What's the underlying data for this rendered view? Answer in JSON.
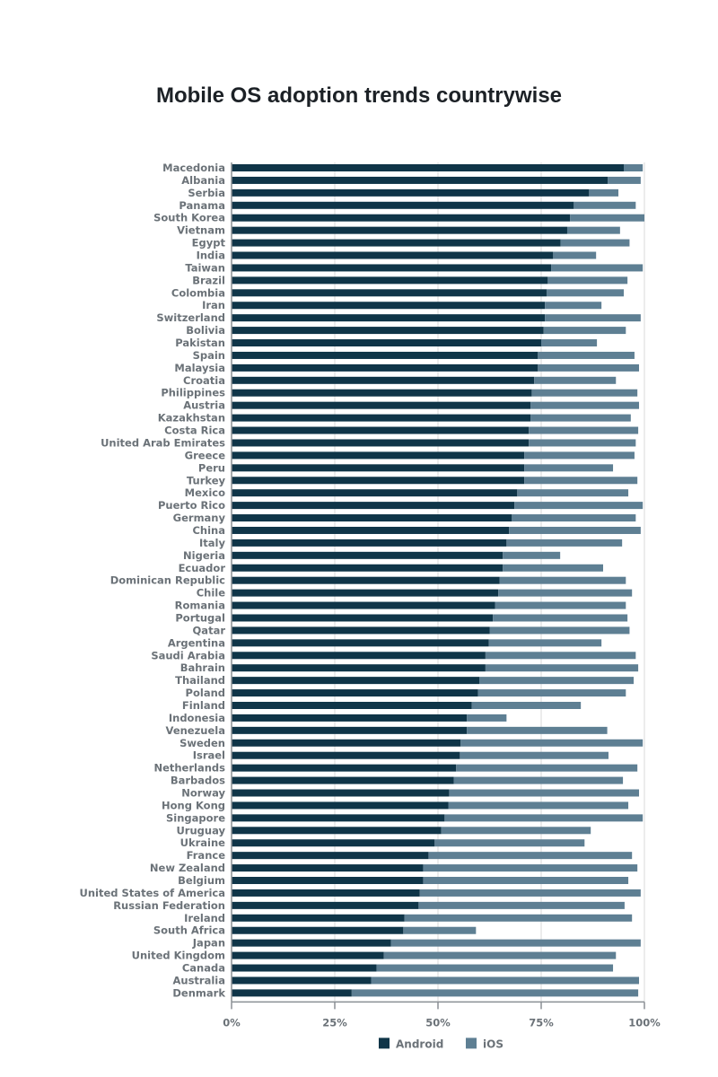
{
  "chart_data": {
    "type": "bar",
    "orientation": "horizontal",
    "stacked": true,
    "title": "Mobile OS adoption trends countrywise",
    "xlabel": "",
    "ylabel": "",
    "xlim": [
      0,
      100
    ],
    "x_ticks": [
      "0%",
      "25%",
      "50%",
      "75%",
      "100%"
    ],
    "x_tick_values": [
      0,
      25,
      50,
      75,
      100
    ],
    "grid": true,
    "legend_position": "bottom-center",
    "colors": {
      "Android": "#0f3548",
      "iOS": "#5e7f93"
    },
    "categories": [
      "Macedonia",
      "Albania",
      "Serbia",
      "Panama",
      "South Korea",
      "Vietnam",
      "Egypt",
      "India",
      "Taiwan",
      "Brazil",
      "Colombia",
      "Iran",
      "Switzerland",
      "Bolivia",
      "Pakistan",
      "Spain",
      "Malaysia",
      "Croatia",
      "Philippines",
      "Austria",
      "Kazakhstan",
      "Costa Rica",
      "United Arab Emirates",
      "Greece",
      "Peru",
      "Turkey",
      "Mexico",
      "Puerto Rico",
      "Germany",
      "China",
      "Italy",
      "Nigeria",
      "Ecuador",
      "Dominican Republic",
      "Chile",
      "Romania",
      "Portugal",
      "Qatar",
      "Argentina",
      "Saudi Arabia",
      "Bahrain",
      "Thailand",
      "Poland",
      "Finland",
      "Indonesia",
      "Venezuela",
      "Sweden",
      "Israel",
      "Netherlands",
      "Barbados",
      "Norway",
      "Hong Kong",
      "Singapore",
      "Uruguay",
      "Ukraine",
      "France",
      "New Zealand",
      "Belgium",
      "United States of America",
      "Russian Federation",
      "Ireland",
      "South Africa",
      "Japan",
      "United Kingdom",
      "Canada",
      "Australia",
      "Denmark"
    ],
    "series": [
      {
        "name": "Android",
        "values": [
          95.0,
          91.1,
          86.6,
          82.9,
          82.0,
          81.3,
          79.7,
          77.9,
          77.4,
          76.6,
          76.3,
          75.9,
          75.9,
          75.6,
          75.0,
          74.2,
          74.2,
          73.3,
          72.7,
          72.4,
          72.4,
          72.0,
          72.0,
          70.9,
          70.9,
          70.9,
          69.2,
          68.5,
          67.9,
          67.2,
          66.6,
          65.7,
          65.7,
          64.9,
          64.6,
          63.8,
          63.3,
          62.5,
          62.3,
          61.5,
          61.5,
          60.0,
          59.7,
          58.2,
          57.0,
          57.0,
          55.5,
          55.3,
          54.4,
          53.8,
          52.7,
          52.5,
          51.6,
          50.8,
          49.2,
          47.7,
          46.4,
          46.4,
          45.6,
          45.3,
          41.9,
          41.6,
          38.6,
          36.9,
          35.1,
          33.8,
          29.1
        ]
      },
      {
        "name": "iOS",
        "values": [
          4.6,
          8.0,
          7.1,
          15.0,
          18.0,
          12.8,
          16.7,
          10.4,
          22.2,
          19.3,
          18.7,
          13.7,
          23.2,
          19.9,
          13.5,
          23.4,
          24.5,
          19.8,
          25.6,
          26.3,
          24.3,
          26.5,
          25.9,
          26.7,
          21.5,
          27.4,
          26.9,
          31.1,
          30.0,
          31.9,
          28.0,
          13.9,
          24.3,
          30.6,
          32.4,
          31.7,
          32.6,
          33.9,
          27.3,
          36.4,
          37.0,
          37.4,
          35.8,
          26.4,
          9.6,
          34.0,
          44.1,
          36.0,
          43.9,
          41.0,
          46.0,
          43.6,
          48.0,
          36.2,
          36.3,
          49.3,
          51.9,
          49.7,
          53.5,
          49.9,
          55.1,
          17.6,
          60.5,
          56.2,
          57.3,
          64.9,
          69.4
        ]
      }
    ]
  }
}
